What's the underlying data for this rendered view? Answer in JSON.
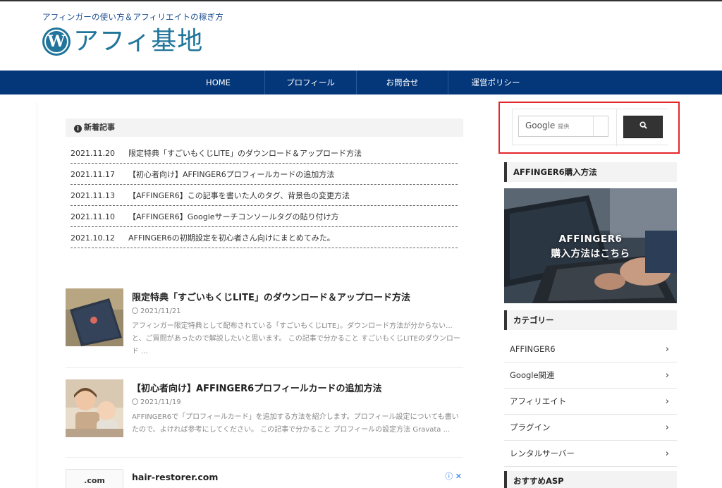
{
  "header": {
    "tagline": "アフィンガーの使い方＆アフィリエイトの稼ぎ方",
    "site_title": "アフィ基地",
    "logo_letter": "W"
  },
  "nav": {
    "items": [
      {
        "label": "HOME"
      },
      {
        "label": "プロフィール"
      },
      {
        "label": "お問合せ"
      },
      {
        "label": "運営ポリシー"
      }
    ]
  },
  "new_articles": {
    "heading": "新着記事",
    "items": [
      {
        "date": "2021.11.20",
        "title": "限定特典「すごいもくじLITE」のダウンロード＆アップロード方法"
      },
      {
        "date": "2021.11.17",
        "title": "【初心者向け】AFFINGER6プロフィールカードの追加方法"
      },
      {
        "date": "2021.11.13",
        "title": "【AFFINGER6】この記事を書いた人のタグ、背景色の変更方法"
      },
      {
        "date": "2021.11.10",
        "title": "【AFFINGER6】Googleサーチコンソールタグの貼り付け方"
      },
      {
        "date": "2021.10.12",
        "title": "AFFINGER6の初期設定を初心者さん向けにまとめてみた。"
      }
    ]
  },
  "posts": [
    {
      "title": "限定特典「すごいもくじLITE」のダウンロード＆アップロード方法",
      "date": "2021/11/21",
      "excerpt": "アフィンガー限定特典として配布されている「すごいもくじLITE」。ダウンロード方法が分からない...と、ご質問があったので解説したいと思います。 この記事で分かること すごいもくじLITEのダウンロード ..."
    },
    {
      "title": "【初心者向け】AFFINGER6プロフィールカードの追加方法",
      "date": "2021/11/19",
      "excerpt": "AFFINGER6で「プロフィールカード」を追加する方法を紹介します。プロフィール設定についても書いたので、よければ参考にしてください。 この記事で分かること プロフィールの設定方法 Gravata ..."
    }
  ],
  "ad": {
    "thumb_text": ".com",
    "title": "hair-restorer.com",
    "icons": "ⓘ ✕"
  },
  "sidebar": {
    "search": {
      "brand": "Google",
      "brand_suffix": "提供"
    },
    "purchase_heading": "AFFINGER6購入方法",
    "banner_line1": "AFFINGER6",
    "banner_line2": "購入方法はこちら",
    "category_heading": "カテゴリー",
    "categories": [
      {
        "label": "AFFINGER6"
      },
      {
        "label": "Google関連"
      },
      {
        "label": "アフィリエイト"
      },
      {
        "label": "プラグイン"
      },
      {
        "label": "レンタルサーバー"
      }
    ],
    "asp_heading": "おすすめASP"
  },
  "colors": {
    "nav_bg": "#04377a",
    "brand_blue": "#21759b",
    "highlight_red": "#e4262a"
  }
}
